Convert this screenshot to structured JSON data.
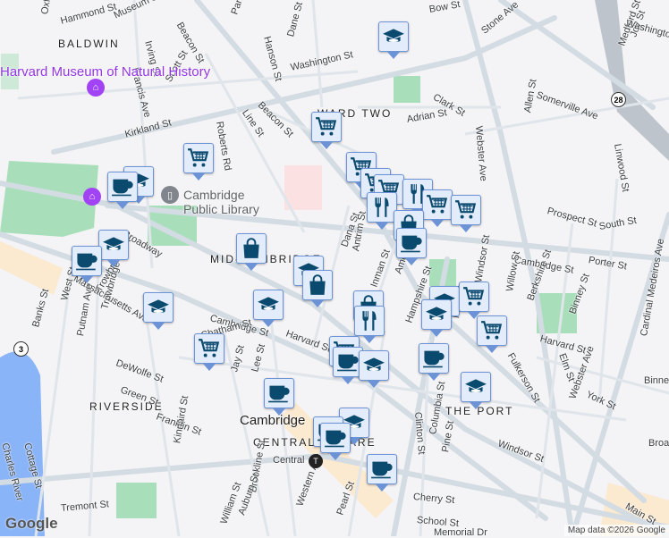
{
  "map": {
    "neighborhoods": [
      "BALDWIN",
      "MID-CAMBRIDGE",
      "RIVERSIDE",
      "THE PORT",
      "CENTRAL SQUARE",
      "WARD TWO",
      "Cambridge"
    ],
    "poi": {
      "museum": "Harvard Museum of Natural History",
      "library": "Cambridge Public Library",
      "transit": "Central"
    },
    "streets": [
      "Hammond St",
      "Museum St",
      "Oxford St",
      "Beacon St",
      "Park St",
      "Dane St",
      "Hanson St",
      "Bow St",
      "Washington St",
      "Irving St",
      "Francis Ave",
      "Scott St",
      "Kirkland St",
      "Line St",
      "Beacon St",
      "Roberts Rd",
      "Trowbridge St",
      "Adrian St",
      "Clark St",
      "Stone Ave",
      "Somerville Ave",
      "Webster Ave",
      "Allen St",
      "Linwood St",
      "Medford St",
      "Joy St",
      "Washington St",
      "Cambridge St",
      "Broadway",
      "Massachusetts Ave",
      "Dana St",
      "Antrim St",
      "Inman St",
      "Amory St",
      "Prospect St",
      "South St",
      "Porter St",
      "Cambridge St",
      "Chatham St",
      "Harvard St",
      "West St",
      "Trowbridge St",
      "Putnam Ave",
      "Banks St",
      "DeWolfe St",
      "Green St",
      "Franklin St",
      "Kinnaird St",
      "Jay St",
      "Lee St",
      "Clinton St",
      "Columbia St",
      "Pine St",
      "Cherry St",
      "School St",
      "Main St",
      "Windsor St",
      "Harvard St",
      "York St",
      "Binney St",
      "Berkshire St",
      "Willow St",
      "Windsor St",
      "Elm St",
      "Webster Ave",
      "Cardinal Medeiros Ave",
      "Fulkerson St",
      "Hampshire St",
      "Tremont St",
      "Western Ave",
      "Pearl St",
      "Brookline St",
      "Auburn St",
      "William St",
      "Cottage St",
      "Charles River",
      "Memorial Dr",
      "Main St",
      "Broadway",
      "Binney St",
      "Fulkerson St"
    ],
    "route_shields": [
      "28",
      "3"
    ],
    "water_label": "Charles River"
  },
  "markers": [
    "school",
    "cart",
    "cart",
    "school",
    "coffee",
    "school",
    "coffee",
    "bag",
    "school",
    "bag",
    "cart",
    "cart",
    "cart",
    "fork",
    "cart",
    "cart",
    "fork",
    "bag",
    "coffee",
    "school",
    "school",
    "cart",
    "bag",
    "fork",
    "cart",
    "coffee",
    "school",
    "school",
    "cart",
    "school",
    "cart",
    "coffee",
    "school",
    "school",
    "coffee",
    "coffee",
    "coffee",
    "coffee"
  ],
  "footer": {
    "logo": "Google",
    "attribution": "Map data ©2026 Google"
  },
  "colors": {
    "marker_bg": "#e3ecfb",
    "marker_icon": "#0b4a6f",
    "park": "#b7e4c7",
    "water": "#8ab4f8"
  }
}
